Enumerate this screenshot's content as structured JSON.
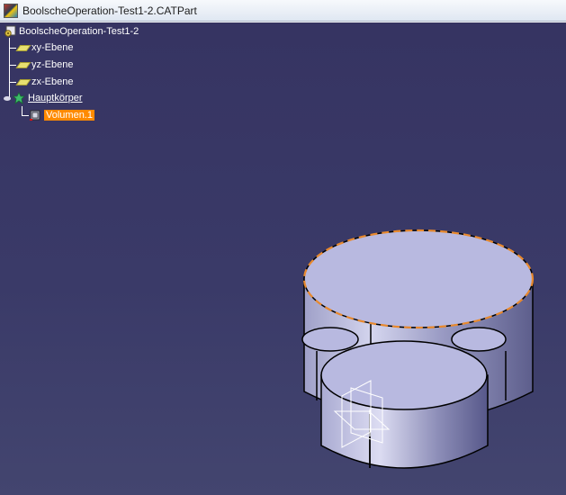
{
  "window": {
    "title": "BoolscheOperation-Test1-2.CATPart"
  },
  "tree": {
    "root_label": "BoolscheOperation-Test1-2",
    "planes": [
      {
        "label": "xy-Ebene"
      },
      {
        "label": "yz-Ebene"
      },
      {
        "label": "zx-Ebene"
      }
    ],
    "body": {
      "label": "Hauptkörper",
      "children": [
        {
          "label": "Volumen.1",
          "selected": true
        }
      ]
    }
  },
  "icons": {
    "app": "catia-app-icon",
    "part": "part-gear-icon",
    "plane": "plane-icon",
    "body": "body-icon",
    "volume": "volume-icon"
  },
  "colors": {
    "background_top": "#363462",
    "background_bottom": "#43456f",
    "selection": "#ff8a00",
    "solid_face": "#b8b9e0",
    "highlight_edge": "#e8892e"
  }
}
